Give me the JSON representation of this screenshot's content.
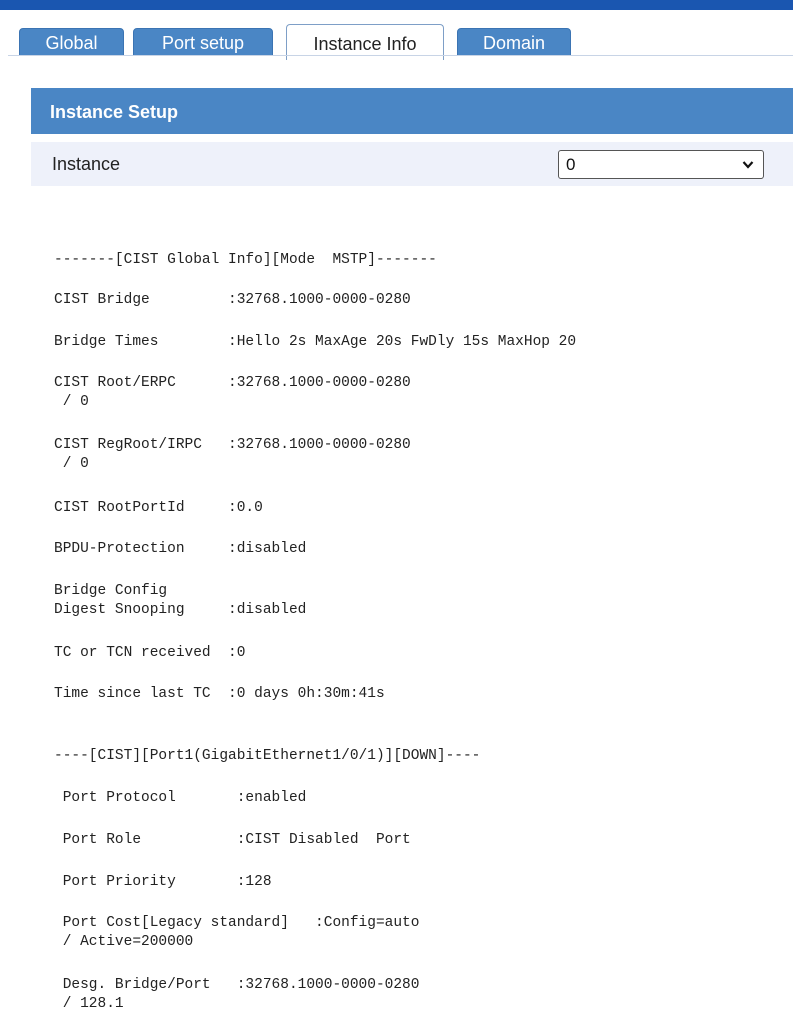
{
  "tabs": [
    {
      "label": "Global",
      "active": false
    },
    {
      "label": "Port setup",
      "active": false
    },
    {
      "label": "Instance Info",
      "active": true
    },
    {
      "label": "Domain",
      "active": false
    }
  ],
  "section": {
    "title": "Instance Setup"
  },
  "instance": {
    "label": "Instance",
    "value": "0"
  },
  "output": [
    "-------[CIST Global Info][Mode  MSTP]-------",
    "CIST Bridge         :32768.1000-0000-0280",
    "Bridge Times        :Hello 2s MaxAge 20s FwDly 15s MaxHop 20",
    "CIST Root/ERPC      :32768.1000-0000-0280",
    " / 0",
    "CIST RegRoot/IRPC   :32768.1000-0000-0280",
    " / 0",
    "CIST RootPortId     :0.0",
    "BPDU-Protection     :disabled",
    "Bridge Config",
    "Digest Snooping     :disabled",
    "TC or TCN received  :0",
    "Time since last TC  :0 days 0h:30m:41s",
    "----[CIST][Port1(GigabitEthernet1/0/1)][DOWN]----",
    " Port Protocol       :enabled",
    " Port Role           :CIST Disabled  Port",
    " Port Priority       :128",
    " Port Cost[Legacy standard]   :Config=auto",
    " / Active=200000",
    " Desg. Bridge/Port   :32768.1000-0000-0280",
    " / 128.1"
  ],
  "colors": {
    "tab_blue": "#4a86c5",
    "top_bar": "#1a56b0",
    "row_bg": "#eef1fa"
  }
}
